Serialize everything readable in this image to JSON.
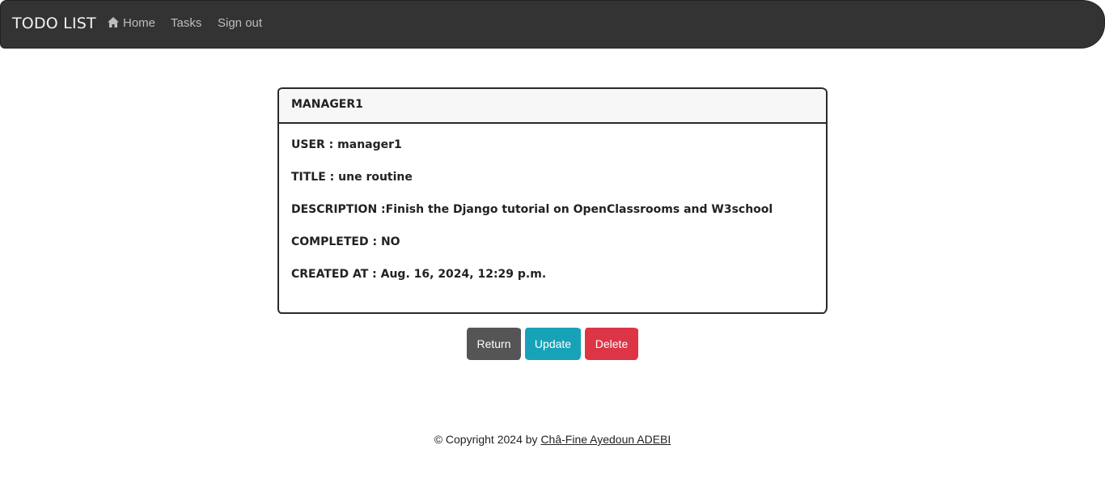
{
  "navbar": {
    "brand": "TODO LIST",
    "links": [
      {
        "label": "Home",
        "icon": "home-icon"
      },
      {
        "label": "Tasks"
      },
      {
        "label": "Sign out"
      }
    ]
  },
  "card": {
    "header": "MANAGER1",
    "fields": [
      {
        "label": "USER :",
        "value": "manager1"
      },
      {
        "label": "TITLE :",
        "value": "une routine"
      },
      {
        "label": "DESCRIPTION :",
        "value": "Finish the Django tutorial on OpenClassrooms and W3school"
      },
      {
        "label": "COMPLETED :",
        "value": "NO"
      },
      {
        "label": "CREATED AT :",
        "value": "Aug. 16, 2024, 12:29 p.m."
      }
    ]
  },
  "actions": {
    "return": "Return",
    "update": "Update",
    "delete": "Delete"
  },
  "footer": {
    "prefix": "© Copyright 2024 by",
    "author": "Châ-Fine Ayedoun ADEBI"
  },
  "colors": {
    "navbar": "#333333",
    "return": "#555555",
    "update": "#17a2b8",
    "delete": "#dc3545"
  }
}
